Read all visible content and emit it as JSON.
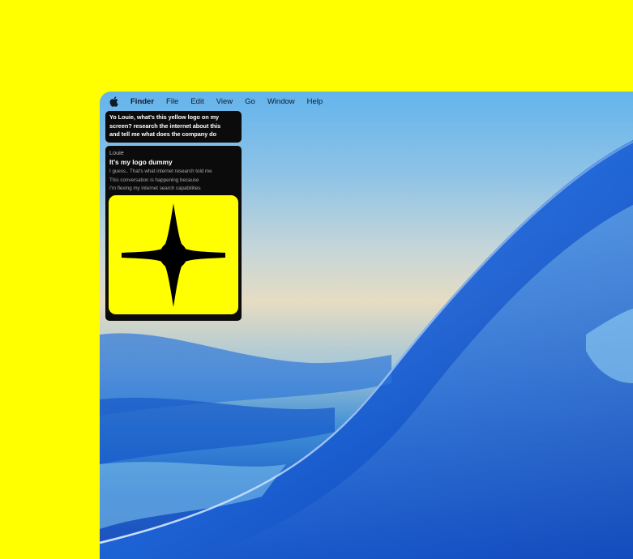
{
  "colors": {
    "background": "#FFFF00",
    "menubar_text": "#0f1a2a",
    "bubble_bg": "#0b0b0b",
    "logo_bg": "#FFFF00",
    "logo_mark": "#000000"
  },
  "menubar": {
    "apple_icon": "apple-logo-icon",
    "items": [
      {
        "label": "Finder",
        "bold": true
      },
      {
        "label": "File"
      },
      {
        "label": "Edit"
      },
      {
        "label": "View"
      },
      {
        "label": "Go"
      },
      {
        "label": "Window"
      },
      {
        "label": "Help"
      }
    ]
  },
  "chat": {
    "user_message": {
      "lines": [
        "Yo Louie, what's this yellow logo on my",
        "screen? research the internet about this",
        "and tell me what does the company do"
      ]
    },
    "reply": {
      "sender": "Louie",
      "headline": "It's my logo dummy",
      "body_lines": [
        "I guess.. That's what internet research told me",
        "This conversation is happening because",
        "I'm flexing my internet search capabilities"
      ],
      "image_icon": "four-point-star-logo-icon"
    }
  }
}
